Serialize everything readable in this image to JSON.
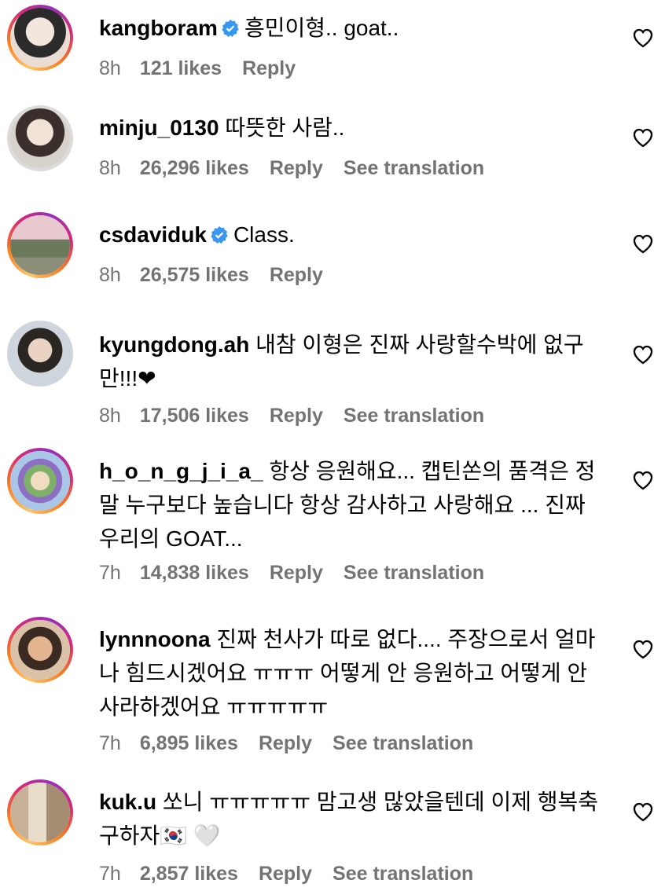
{
  "comments": [
    {
      "username": "kangboram",
      "verified": true,
      "text": "흥민이형.. goat..",
      "time": "8h",
      "likes": "121 likes",
      "reply": "Reply",
      "translate": "",
      "ring": "story",
      "avatar_color": "#e8d5c8"
    },
    {
      "username": "minju_0130",
      "verified": false,
      "text": "따뜻한 사람..",
      "time": "8h",
      "likes": "26,296 likes",
      "reply": "Reply",
      "translate": "See translation",
      "ring": "seen",
      "avatar_color": "#d9cfc8"
    },
    {
      "username": "csdaviduk",
      "verified": true,
      "text": "Class.",
      "time": "8h",
      "likes": "26,575 likes",
      "reply": "Reply",
      "translate": "",
      "ring": "story",
      "avatar_color": "#9aa38a"
    },
    {
      "username": "kyungdong.ah",
      "verified": false,
      "text": "내참 이형은 진짜 사랑할수박에 없구만!!!❤",
      "time": "8h",
      "likes": "17,506 likes",
      "reply": "Reply",
      "translate": "See translation",
      "ring": "none",
      "avatar_color": "#c7ccd3"
    },
    {
      "username": "h_o_n_g_j_i_a_",
      "verified": false,
      "text": "항상 응원해요... 캡틴쏜의 품격은 정말 누구보다 높습니다 항상 감사하고 사랑해요 ... 진짜 우리의 GOAT...",
      "time": "7h",
      "likes": "14,838 likes",
      "reply": "Reply",
      "translate": "See translation",
      "ring": "story",
      "avatar_color": "#8fb5d8"
    },
    {
      "username": "lynnnoona",
      "verified": false,
      "text": "진짜 천사가 따로 없다.... 주장으로서 얼마나 힘드시겠어요 ㅠㅠㅠ 어떻게 안 응원하고 어떻게 안 사라하겠어요 ㅠㅠㅠㅠㅠ",
      "time": "7h",
      "likes": "6,895 likes",
      "reply": "Reply",
      "translate": "See translation",
      "ring": "story",
      "avatar_color": "#c99a7a"
    },
    {
      "username": "kuk.u",
      "verified": false,
      "text": "쏘니 ㅠㅠㅠㅠㅠ 맘고생 많았을텐데 이제 행복축구하자🇰🇷 🤍",
      "time": "7h",
      "likes": "2,857 likes",
      "reply": "Reply",
      "translate": "See translation",
      "ring": "story",
      "avatar_color": "#b8a58e"
    }
  ],
  "colors": {
    "verified": "#3897f0",
    "meta": "#737373",
    "text": "#000000"
  }
}
